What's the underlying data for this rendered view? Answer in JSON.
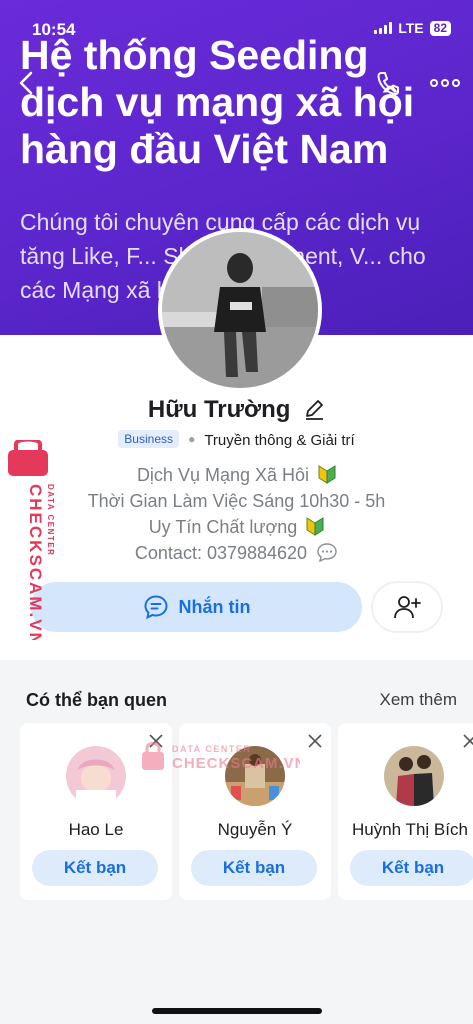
{
  "status_bar": {
    "time": "10:54",
    "network": "LTE",
    "battery": "82"
  },
  "cover": {
    "title": "Hệ thống Seeding dịch vụ mạng xã hội hàng đầu Việt Nam",
    "description": "Chúng tôi chuyên cung cấp các dịch vụ tăng Like, F... Share, Comment, V... cho các Mạng xã hộ... k."
  },
  "profile": {
    "name": "Hữu Trường",
    "badge": "Business",
    "category": "Truyền thông & Giải trí",
    "bio": [
      "Dịch Vụ Mạng Xã Hôi",
      "Thời Gian Làm Việc Sáng 10h30 - 5h",
      "Uy Tín Chất lượng",
      "Contact: 0379884620"
    ],
    "message_label": "Nhắn tin"
  },
  "watermark": {
    "line1": "DATA CENTER",
    "line2": "CHECKSCAM.VN"
  },
  "suggestions": {
    "title": "Có thể bạn quen",
    "see_more": "Xem thêm",
    "add_label": "Kết bạn",
    "people": [
      {
        "name": "Hao Le"
      },
      {
        "name": "Nguyễn Ý"
      },
      {
        "name": "Huỳnh Thị Bích"
      }
    ]
  },
  "colors": {
    "cover": "#5b26cc",
    "accent": "#1a6fe0",
    "button_bg": "#d4e6fb",
    "watermark": "#e5395b"
  }
}
